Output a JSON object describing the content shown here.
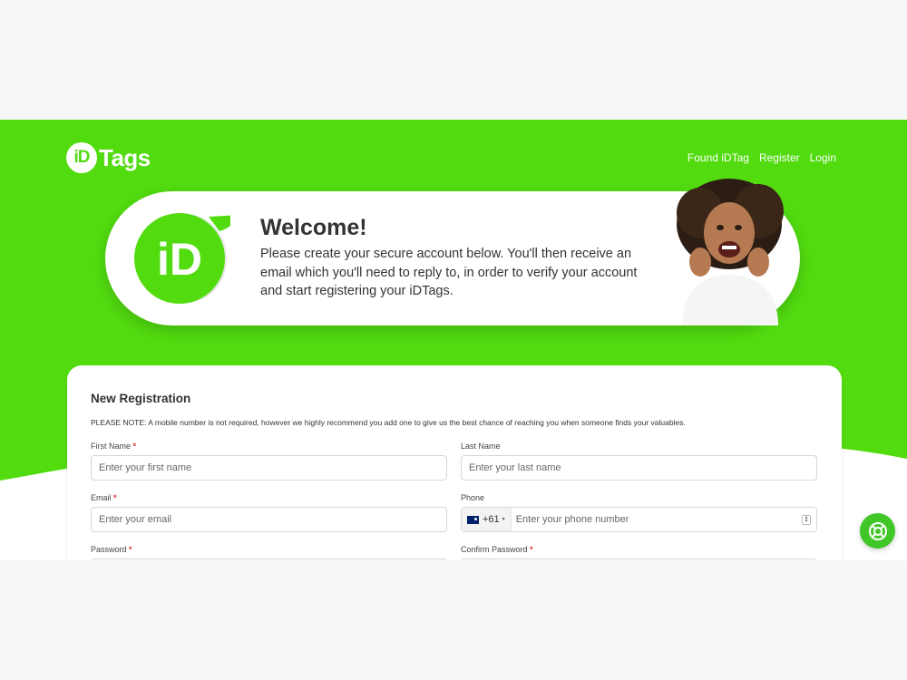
{
  "brand": {
    "logo_mark": "iD",
    "logo_text": "Tags",
    "accent": "#52dc10"
  },
  "nav": {
    "items": [
      "Found iDTag",
      "Register",
      "Login"
    ]
  },
  "welcome": {
    "title": "Welcome!",
    "text": "Please create your secure account below. You'll then receive an email which you'll need to reply to, in order to verify your account and start registering your iDTags.",
    "badge_text": "iD"
  },
  "form": {
    "title": "New Registration",
    "note": "PLEASE NOTE: A mobile number is not required, however we highly recommend you add one to give us the best chance of reaching you when someone finds your valuables.",
    "first_name": {
      "label": "First Name",
      "required": "*",
      "placeholder": "Enter your first name"
    },
    "last_name": {
      "label": "Last Name",
      "placeholder": "Enter your last name"
    },
    "email": {
      "label": "Email",
      "required": "*",
      "placeholder": "Enter your email"
    },
    "phone": {
      "label": "Phone",
      "country_code": "+61",
      "caret": "▾",
      "placeholder": "Enter your phone number"
    },
    "password": {
      "label": "Password",
      "required": "*"
    },
    "confirm_password": {
      "label": "Confirm Password",
      "required": "*"
    }
  },
  "help_button": {
    "icon": "lifebuoy-icon"
  }
}
